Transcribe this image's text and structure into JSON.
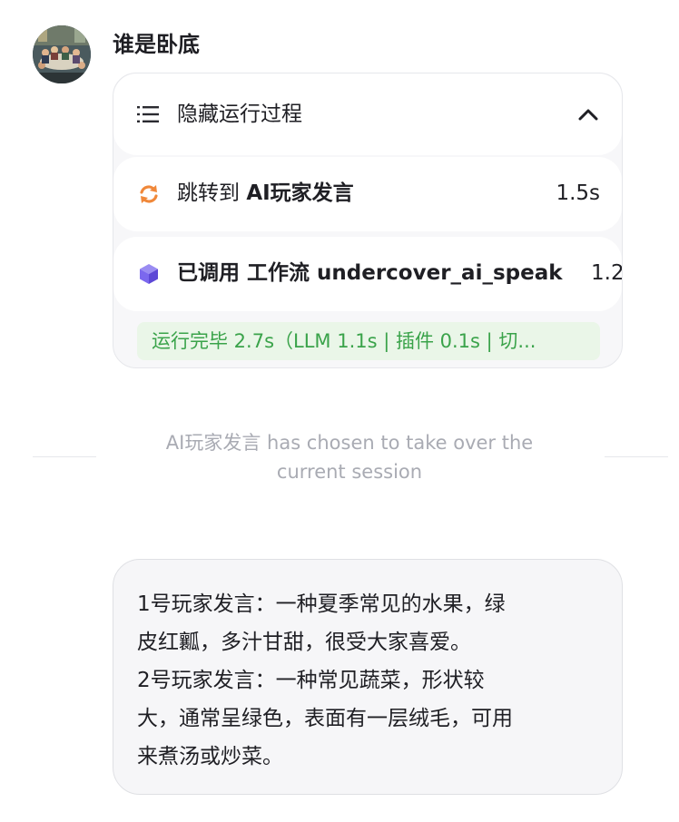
{
  "bot": {
    "name": "谁是卧底",
    "avatar_icon": "avatar-photo"
  },
  "process": {
    "toggle_label": "隐藏运行过程",
    "toggle_icon": "list-icon",
    "collapse_icon": "chevron-up-icon",
    "steps": [
      {
        "icon": "refresh-icon",
        "icon_color": "#f0883a",
        "prefix": "跳转到 ",
        "target": "AI玩家发言",
        "time": "1.5s"
      },
      {
        "icon": "cube-icon",
        "icon_color": "#7b68ee",
        "prefix": "已调用 ",
        "target": "工作流 undercover_ai_speak",
        "time": "1.2"
      }
    ],
    "summary": "运行完毕 2.7s（LLM 1.1s | 插件 0.1s | 切...",
    "summary_color": "#3aa34a"
  },
  "notice": {
    "line1": "AI玩家发言 has chosen to take over the",
    "line2": "current session"
  },
  "message": {
    "lines": [
      "1号玩家发言：一种夏季常见的水果，绿",
      "皮红瓤，多汁甘甜，很受大家喜爱。",
      "2号玩家发言：一种常见蔬菜，形状较",
      "大，通常呈绿色，表面有一层绒毛，可用",
      "来煮汤或炒菜。"
    ]
  }
}
